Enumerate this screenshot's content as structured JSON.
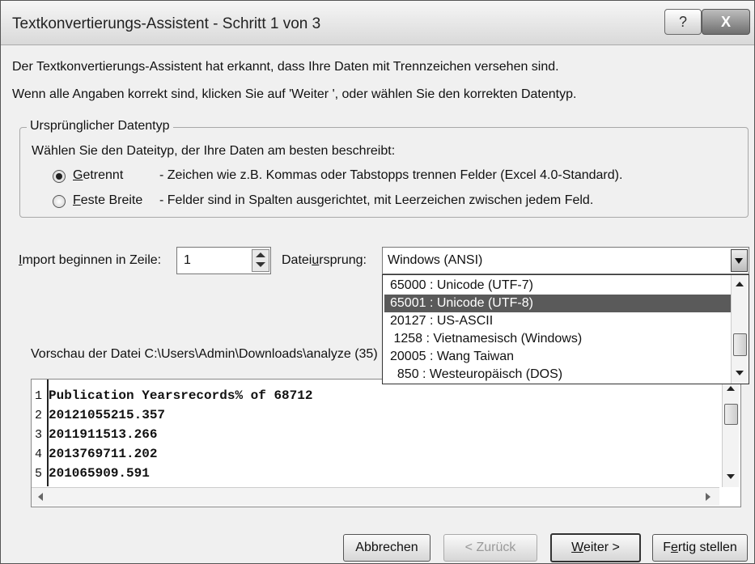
{
  "window": {
    "title": "Textkonvertierungs-Assistent - Schritt 1 von 3",
    "help_glyph": "?",
    "close_glyph": "X"
  },
  "intro": {
    "line1": "Der Textkonvertierungs-Assistent hat erkannt, dass Ihre Daten mit Trennzeichen versehen sind.",
    "line2": "Wenn alle Angaben korrekt sind, klicken Sie auf 'Weiter ', oder wählen Sie den korrekten Datentyp."
  },
  "datatype_group": {
    "legend": "Ursprünglicher Datentyp",
    "prompt": "Wählen Sie den Dateityp, der Ihre Daten am besten beschreibt:",
    "options": [
      {
        "label_mnemonic": "G",
        "label_rest": "etrennt",
        "description": "- Zeichen wie z.B. Kommas oder Tabstopps trennen Felder (Excel 4.0-Standard).",
        "selected": true
      },
      {
        "label_mnemonic": "F",
        "label_rest": "este Breite",
        "description": "- Felder sind in Spalten ausgerichtet, mit Leerzeichen zwischen jedem Feld.",
        "selected": false
      }
    ]
  },
  "import_row": {
    "label_mnemonic": "I",
    "label_rest": "mport beginnen in Zeile:",
    "value": "1"
  },
  "origin": {
    "label_before": "Datei",
    "label_mnemonic": "u",
    "label_after": "rsprung:",
    "value": "Windows (ANSI)",
    "options": [
      {
        "label": "65000 : Unicode (UTF-7)",
        "selected": false
      },
      {
        "label": "65001 : Unicode (UTF-8)",
        "selected": true
      },
      {
        "label": "20127 : US-ASCII",
        "selected": false
      },
      {
        "label": " 1258 : Vietnamesisch (Windows)",
        "selected": false
      },
      {
        "label": "20005 : Wang Taiwan",
        "selected": false
      },
      {
        "label": "  850 : Westeuropäisch (DOS)",
        "selected": false
      }
    ]
  },
  "preview": {
    "label": "Vorschau der Datei C:\\Users\\Admin\\Downloads\\analyze (35)",
    "rows": [
      {
        "num": "1",
        "text": "Publication Yearsrecords% of 68712"
      },
      {
        "num": "2",
        "text": "20121055215.357"
      },
      {
        "num": "3",
        "text": "2011911513.266"
      },
      {
        "num": "4",
        "text": "2013769711.202"
      },
      {
        "num": "5",
        "text": "201065909.591"
      }
    ]
  },
  "buttons": {
    "cancel": "Abbrechen",
    "back": "< Zurück",
    "next_mnemonic": "W",
    "next_rest": "eiter >",
    "finish_before": "F",
    "finish_mnemonic": "e",
    "finish_after": "rtig stellen"
  }
}
